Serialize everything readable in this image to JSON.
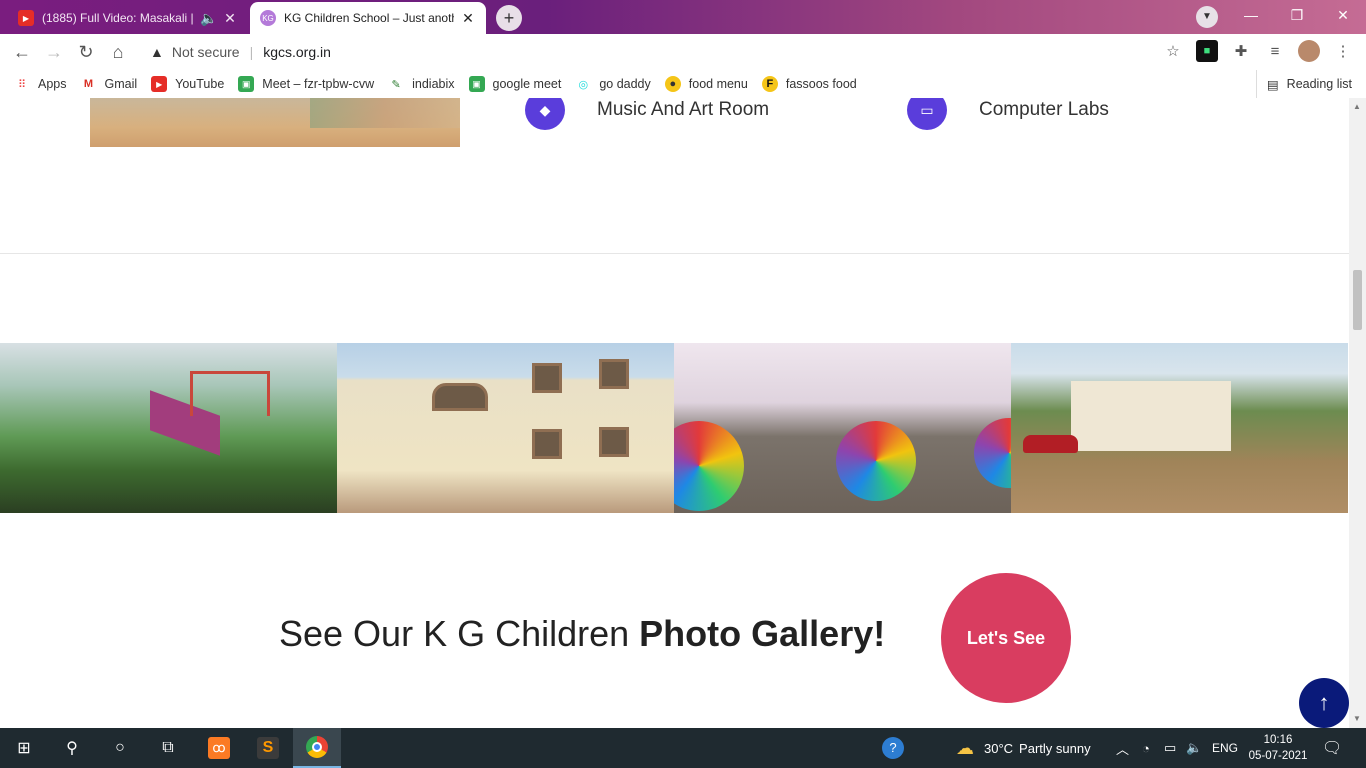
{
  "browser": {
    "tabs": [
      {
        "title": "(1885) Full Video: Masakali |",
        "favicon": "youtube-icon",
        "audio": true
      },
      {
        "title": "KG Children School – Just anothe",
        "favicon": "kgcs-icon"
      }
    ],
    "new_tab": "+",
    "window_buttons": [
      "—",
      "❐",
      "✕"
    ],
    "omnibox": {
      "security": "Not secure",
      "url": "kgcs.org.in"
    },
    "bookmarks": [
      {
        "label": "Apps",
        "icon": "apps-grid-icon"
      },
      {
        "label": "Gmail",
        "icon": "gmail-icon"
      },
      {
        "label": "YouTube",
        "icon": "youtube-icon"
      },
      {
        "label": "Meet – fzr-tpbw-cvw",
        "icon": "meet-icon"
      },
      {
        "label": "indiabix",
        "icon": "indiabix-icon"
      },
      {
        "label": "google meet",
        "icon": "meet-icon"
      },
      {
        "label": "go daddy",
        "icon": "godaddy-icon"
      },
      {
        "label": "food menu",
        "icon": "food-icon"
      },
      {
        "label": "fassoos food",
        "icon": "fassos-icon"
      }
    ],
    "reading_list": "Reading list"
  },
  "page": {
    "features": [
      {
        "label": "Music And Art Room",
        "icon": "music-icon"
      },
      {
        "label": "Computer Labs",
        "icon": "monitor-icon"
      }
    ],
    "gallery": [
      {
        "name": "playground-photo"
      },
      {
        "name": "school-building-photo"
      },
      {
        "name": "dance-performance-photo"
      },
      {
        "name": "campus-garden-photo"
      }
    ],
    "cta": {
      "text_plain": "See Our K G Children ",
      "text_bold": "Photo Gallery!",
      "button": "Let's See"
    },
    "back_to_top": "↑"
  },
  "taskbar": {
    "weather": {
      "temp": "30°C",
      "desc": "Partly sunny"
    },
    "language": "ENG",
    "time": "10:16",
    "date": "05-07-2021"
  },
  "colors": {
    "accent_purple": "#5a3ddb",
    "cta_pink": "#d93d60",
    "back_to_top_navy": "#0a1a7a"
  }
}
